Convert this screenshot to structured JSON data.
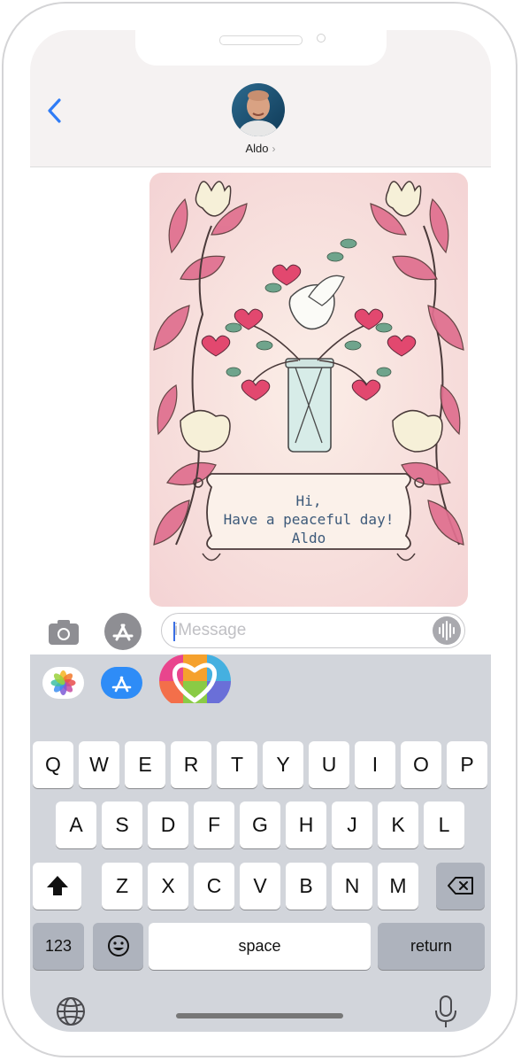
{
  "header": {
    "contact_name": "Aldo",
    "back_icon": "chevron-left-icon"
  },
  "message_card": {
    "greeting": "Hi,",
    "line": "Have a peaceful day!",
    "signature": "Aldo"
  },
  "input_bar": {
    "placeholder": "iMessage",
    "camera_icon": "camera-icon",
    "appstore_icon": "app-store-icon",
    "audio_icon": "audio-waveform-icon"
  },
  "app_drawer": {
    "apps": [
      "photos",
      "app-store",
      "heart-stickers"
    ]
  },
  "keyboard": {
    "row1": [
      "Q",
      "W",
      "E",
      "R",
      "T",
      "Y",
      "U",
      "I",
      "O",
      "P"
    ],
    "row2": [
      "A",
      "S",
      "D",
      "F",
      "G",
      "H",
      "J",
      "K",
      "L"
    ],
    "row3": [
      "Z",
      "X",
      "C",
      "V",
      "B",
      "N",
      "M"
    ],
    "numbers_label": "123",
    "space_label": "space",
    "return_label": "return"
  },
  "colors": {
    "accent": "#2f7cf6",
    "keyboard_bg": "#d2d5db",
    "card_text": "#3d5a7a"
  }
}
